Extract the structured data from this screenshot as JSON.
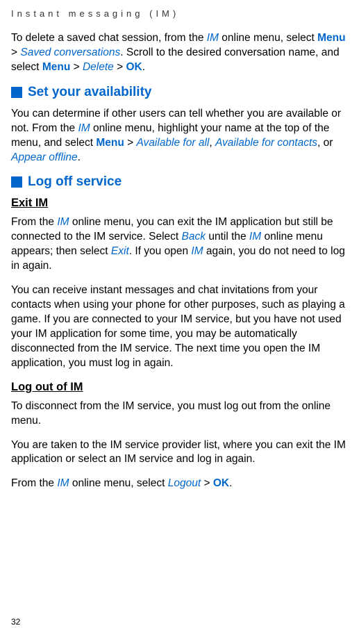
{
  "header": {
    "title": "Instant messaging (IM)"
  },
  "intro": {
    "text_start": "To delete a saved chat session, from the ",
    "im_link": "IM",
    "text_mid1": " online menu, select ",
    "menu_bold": "Menu",
    "gt1": " > ",
    "saved_conv": "Saved conversations",
    "text_mid2": ". Scroll to the desired conversation name, and select ",
    "menu_bold2": "Menu",
    "gt2": " > ",
    "delete": "Delete",
    "gt3": " > ",
    "ok": "OK",
    "period": "."
  },
  "section1": {
    "heading": "Set your availability",
    "para_start": "You can determine if other users can tell whether you are available or not. From the ",
    "im_link": "IM",
    "para_mid1": " online menu, highlight your name at the top of the menu, and select ",
    "menu_bold": "Menu",
    "gt1": " > ",
    "avail_all": "Available for all",
    "comma1": ", ",
    "avail_contacts": "Available for contacts",
    "comma2": ", or ",
    "appear_offline": "Appear offline",
    "period": "."
  },
  "section2": {
    "heading": "Log off service",
    "sub1": {
      "title": "Exit IM",
      "p1_start": "From the ",
      "im1": "IM",
      "p1_mid1": " online menu, you can exit the IM application but still be connected to the IM service. Select ",
      "back": "Back",
      "p1_mid2": " until the ",
      "im2": "IM",
      "p1_mid3": " online menu appears; then select ",
      "exit": "Exit",
      "p1_mid4": ". If you open ",
      "im3": "IM",
      "p1_end": " again, you do not need to log in again.",
      "p2": "You can receive instant messages and chat invitations from your contacts when using your phone for other purposes, such as playing a game. If you are connected to your IM service, but you have not used your IM application for some time, you may be automatically disconnected from the IM service. The next time you open the IM application, you must log in again."
    },
    "sub2": {
      "title": "Log out of IM",
      "p1": "To disconnect from the IM service, you must log out from the online menu.",
      "p2": "You are taken to the IM service provider list, where you can exit the IM application or select an IM service and log in again.",
      "p3_start": "From the ",
      "im1": "IM",
      "p3_mid": " online menu, select ",
      "logout": "Logout",
      "gt": " > ",
      "ok": "OK",
      "period": "."
    }
  },
  "page_number": "32"
}
